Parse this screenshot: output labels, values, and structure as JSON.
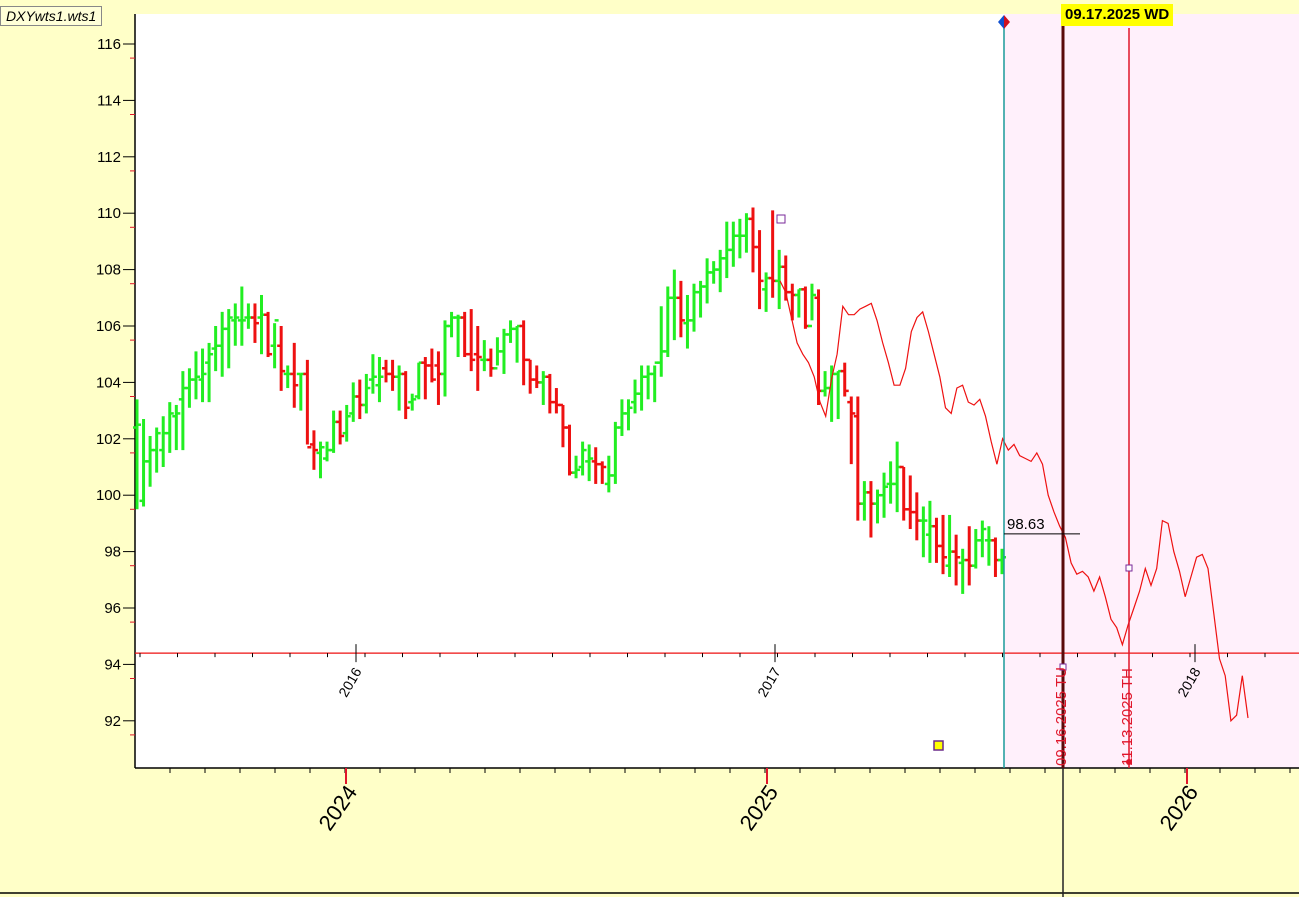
{
  "window": {
    "file_label": "DXYwts1.wts1",
    "selected_date_label": "09.17.2025 WD"
  },
  "chart_data": {
    "type": "bar",
    "y_ticks": [
      116,
      114,
      112,
      110,
      108,
      106,
      104,
      102,
      100,
      98,
      96,
      94,
      92
    ],
    "ylim": [
      90.3,
      117.2
    ],
    "grid": false,
    "price_label": "98.63",
    "outer_year_labels": [
      "2024",
      "2025",
      "2026"
    ],
    "inner_year_labels": [
      "2016",
      "2017",
      "2018"
    ],
    "vertical_labels": [
      "09.16.2025 TU",
      "11.13.2025 TH"
    ],
    "horizontal_line_value": 94.4,
    "colors": {
      "up": "#22ee22",
      "down": "#ee1111",
      "overlay_line": "#ee1111",
      "teal_marker": "#1a9a9a",
      "future_shade": "#fff0fb"
    },
    "price_bars": [
      [
        102.4,
        103.4,
        99.5,
        102.5
      ],
      [
        99.8,
        102.7,
        99.6,
        101.2
      ],
      [
        101.2,
        102.1,
        100.3,
        101.6
      ],
      [
        101.6,
        102.4,
        100.8,
        102.2
      ],
      [
        101.6,
        102.8,
        101.0,
        102.2
      ],
      [
        102.2,
        103.3,
        101.5,
        102.9
      ],
      [
        102.8,
        103.2,
        101.6,
        102.9
      ],
      [
        103.4,
        104.4,
        101.6,
        103.8
      ],
      [
        103.8,
        104.5,
        103.1,
        104.1
      ],
      [
        104.1,
        105.1,
        103.4,
        104.2
      ],
      [
        104.1,
        105.2,
        103.3,
        104.3
      ],
      [
        104.7,
        105.4,
        103.3,
        105.0
      ],
      [
        105.2,
        106.0,
        104.4,
        105.3
      ],
      [
        105.3,
        106.5,
        104.2,
        105.9
      ],
      [
        105.9,
        106.6,
        104.5,
        106.3
      ],
      [
        106.2,
        106.8,
        105.3,
        106.3
      ],
      [
        106.2,
        107.4,
        105.3,
        106.2
      ],
      [
        106.3,
        106.8,
        105.9,
        106.3
      ],
      [
        106.3,
        106.8,
        105.4,
        106.1
      ],
      [
        106.3,
        107.1,
        105.0,
        106.4
      ],
      [
        106.4,
        106.5,
        104.9,
        105.0
      ],
      [
        105.3,
        106.1,
        104.5,
        106.2
      ],
      [
        105.3,
        106.0,
        103.7,
        104.4
      ],
      [
        104.3,
        104.6,
        103.8,
        104.3
      ],
      [
        104.3,
        105.4,
        103.1,
        103.9
      ],
      [
        104.3,
        104.3,
        103.0,
        104.3
      ],
      [
        104.3,
        104.8,
        101.8,
        101.7
      ],
      [
        101.8,
        102.3,
        100.9,
        101.6
      ],
      [
        101.5,
        101.9,
        100.6,
        101.7
      ],
      [
        101.3,
        101.9,
        101.2,
        101.6
      ],
      [
        101.6,
        103.0,
        101.5,
        102.6
      ],
      [
        102.6,
        103.0,
        101.8,
        102.1
      ],
      [
        102.2,
        103.2,
        101.9,
        102.8
      ],
      [
        102.9,
        104.0,
        102.6,
        103.5
      ],
      [
        103.5,
        104.1,
        102.7,
        103.2
      ],
      [
        103.2,
        104.3,
        102.9,
        103.8
      ],
      [
        104.1,
        105.0,
        103.6,
        104.2
      ],
      [
        103.9,
        104.9,
        103.3,
        104.2
      ],
      [
        104.5,
        104.8,
        104.0,
        104.3
      ],
      [
        104.3,
        104.8,
        103.7,
        104.2
      ],
      [
        104.2,
        104.6,
        103.0,
        104.3
      ],
      [
        104.3,
        104.4,
        102.7,
        103.1
      ],
      [
        103.3,
        103.6,
        103.0,
        103.4
      ],
      [
        103.5,
        104.7,
        103.4,
        104.7
      ],
      [
        104.7,
        104.9,
        103.4,
        104.6
      ],
      [
        104.6,
        105.2,
        104.0,
        104.1
      ],
      [
        104.6,
        105.1,
        103.2,
        104.3
      ],
      [
        104.3,
        106.2,
        103.5,
        106.0
      ],
      [
        106.0,
        106.5,
        105.6,
        106.3
      ],
      [
        106.3,
        106.4,
        104.9,
        106.3
      ],
      [
        106.3,
        106.5,
        104.9,
        105.0
      ],
      [
        105.0,
        106.6,
        104.4,
        104.8
      ],
      [
        105.0,
        106.0,
        103.7,
        104.9
      ],
      [
        104.8,
        105.5,
        104.4,
        104.8
      ],
      [
        104.8,
        105.2,
        104.2,
        104.5
      ],
      [
        104.5,
        105.6,
        104.6,
        105.1
      ],
      [
        105.1,
        105.9,
        104.3,
        105.7
      ],
      [
        105.7,
        106.2,
        105.4,
        105.9
      ],
      [
        105.9,
        106.0,
        104.7,
        106.0
      ],
      [
        106.0,
        106.2,
        103.9,
        104.8
      ],
      [
        104.8,
        104.8,
        103.6,
        104.1
      ],
      [
        104.1,
        104.6,
        103.8,
        104.0
      ],
      [
        104.0,
        104.4,
        103.2,
        104.2
      ],
      [
        104.2,
        104.3,
        102.9,
        103.3
      ],
      [
        103.3,
        103.8,
        102.9,
        103.2
      ],
      [
        103.2,
        103.2,
        101.7,
        102.4
      ],
      [
        102.4,
        102.5,
        100.7,
        100.8
      ],
      [
        100.8,
        101.4,
        100.6,
        100.9
      ],
      [
        101.0,
        101.9,
        100.7,
        101.6
      ],
      [
        101.2,
        101.8,
        100.5,
        101.3
      ],
      [
        101.2,
        101.7,
        100.4,
        101.1
      ],
      [
        101.1,
        101.2,
        100.4,
        101.0
      ],
      [
        100.4,
        101.4,
        100.1,
        100.7
      ],
      [
        100.7,
        102.6,
        100.4,
        102.4
      ],
      [
        102.4,
        103.4,
        102.1,
        102.9
      ],
      [
        102.9,
        103.4,
        102.3,
        103.1
      ],
      [
        103.3,
        104.1,
        102.9,
        103.6
      ],
      [
        103.6,
        104.6,
        103.0,
        104.2
      ],
      [
        104.2,
        104.6,
        103.4,
        104.3
      ],
      [
        104.3,
        104.6,
        103.3,
        104.7
      ],
      [
        104.7,
        106.7,
        104.2,
        105.1
      ],
      [
        105.1,
        107.4,
        104.9,
        107.0
      ],
      [
        107.0,
        108.0,
        105.5,
        107.0
      ],
      [
        107.0,
        107.6,
        105.6,
        106.2
      ],
      [
        106.1,
        107.1,
        105.2,
        106.2
      ],
      [
        106.2,
        107.5,
        105.8,
        107.2
      ],
      [
        107.2,
        107.6,
        106.3,
        107.4
      ],
      [
        107.4,
        108.4,
        106.8,
        107.9
      ],
      [
        107.9,
        108.3,
        107.5,
        108.0
      ],
      [
        108.0,
        108.7,
        107.2,
        108.4
      ],
      [
        108.4,
        109.7,
        107.7,
        108.7
      ],
      [
        108.7,
        109.7,
        108.1,
        109.2
      ],
      [
        109.2,
        109.8,
        108.4,
        109.2
      ],
      [
        109.2,
        110.0,
        108.6,
        109.8
      ],
      [
        109.8,
        110.2,
        107.9,
        108.8
      ],
      [
        108.8,
        109.4,
        106.6,
        107.6
      ],
      [
        107.3,
        107.9,
        106.5,
        107.7
      ],
      [
        107.7,
        110.1,
        107.0,
        107.6
      ],
      [
        107.6,
        108.7,
        106.6,
        108.1
      ],
      [
        108.1,
        108.5,
        106.9,
        107.2
      ],
      [
        107.2,
        107.5,
        106.2,
        107.1
      ],
      [
        107.1,
        107.3,
        106.3,
        107.3
      ],
      [
        107.3,
        107.4,
        105.9,
        106.0
      ],
      [
        106.0,
        107.5,
        106.2,
        107.1
      ],
      [
        107.0,
        107.3,
        103.2,
        103.7
      ],
      [
        103.7,
        104.4,
        103.5,
        103.8
      ],
      [
        103.8,
        104.6,
        102.6,
        104.3
      ],
      [
        104.3,
        104.4,
        102.7,
        104.4
      ],
      [
        104.4,
        104.7,
        103.5,
        103.7
      ],
      [
        103.3,
        103.5,
        101.1,
        102.9
      ],
      [
        102.8,
        103.5,
        99.1,
        99.7
      ],
      [
        99.7,
        100.5,
        99.1,
        100.1
      ],
      [
        100.1,
        100.5,
        98.5,
        99.7
      ],
      [
        99.7,
        100.2,
        99.0,
        100.0
      ],
      [
        100.0,
        100.8,
        99.2,
        100.3
      ],
      [
        100.4,
        101.2,
        99.7,
        100.4
      ],
      [
        100.4,
        101.9,
        99.4,
        101.0
      ],
      [
        101.0,
        101.0,
        99.1,
        99.5
      ],
      [
        99.5,
        100.7,
        98.8,
        99.4
      ],
      [
        99.4,
        100.1,
        98.4,
        99.1
      ],
      [
        99.1,
        99.6,
        97.8,
        99.1
      ],
      [
        98.6,
        99.8,
        97.6,
        98.9
      ],
      [
        98.9,
        99.2,
        97.6,
        98.2
      ],
      [
        98.2,
        99.3,
        97.2,
        97.8
      ],
      [
        97.5,
        99.3,
        97.1,
        98.0
      ],
      [
        98.0,
        98.6,
        96.8,
        97.8
      ],
      [
        97.6,
        98.1,
        96.5,
        97.7
      ],
      [
        97.7,
        98.9,
        96.8,
        97.5
      ],
      [
        97.5,
        98.8,
        97.4,
        98.4
      ],
      [
        98.4,
        99.1,
        97.8,
        98.8
      ],
      [
        98.4,
        98.9,
        97.5,
        98.4
      ],
      [
        98.4,
        98.5,
        97.1,
        97.7
      ],
      [
        97.7,
        98.1,
        97.2,
        97.8
      ]
    ],
    "forecast_line": [
      [
        0,
        107.6
      ],
      [
        1,
        107.2
      ],
      [
        2,
        106.3
      ],
      [
        3,
        105.4
      ],
      [
        4,
        105.0
      ],
      [
        5,
        104.7
      ],
      [
        6,
        104.2
      ],
      [
        7,
        103.3
      ],
      [
        8,
        102.8
      ],
      [
        9,
        104.1
      ],
      [
        10,
        105.0
      ],
      [
        11,
        106.7
      ],
      [
        12,
        106.4
      ],
      [
        13,
        106.4
      ],
      [
        14,
        106.6
      ],
      [
        15,
        106.7
      ],
      [
        16,
        106.8
      ],
      [
        17,
        106.2
      ],
      [
        18,
        105.4
      ],
      [
        19,
        104.7
      ],
      [
        20,
        103.9
      ],
      [
        21,
        103.9
      ],
      [
        22,
        104.5
      ],
      [
        23,
        105.8
      ],
      [
        24,
        106.3
      ],
      [
        25,
        106.5
      ],
      [
        26,
        105.8
      ],
      [
        27,
        105.0
      ],
      [
        28,
        104.2
      ],
      [
        29,
        103.1
      ],
      [
        30,
        102.9
      ],
      [
        31,
        103.8
      ],
      [
        32,
        103.9
      ],
      [
        33,
        103.3
      ],
      [
        34,
        103.2
      ],
      [
        35,
        103.4
      ],
      [
        36,
        102.8
      ],
      [
        37,
        101.9
      ],
      [
        38,
        101.1
      ],
      [
        39,
        102.0
      ],
      [
        40,
        101.6
      ],
      [
        41,
        101.8
      ],
      [
        42,
        101.4
      ],
      [
        43,
        101.3
      ],
      [
        44,
        101.2
      ],
      [
        45,
        101.5
      ],
      [
        46,
        101.1
      ],
      [
        47,
        100.0
      ],
      [
        48,
        99.4
      ],
      [
        49,
        98.9
      ],
      [
        50,
        98.5
      ],
      [
        51,
        97.6
      ],
      [
        52,
        97.2
      ],
      [
        53,
        97.3
      ],
      [
        54,
        97.1
      ],
      [
        55,
        96.6
      ],
      [
        56,
        97.1
      ],
      [
        57,
        96.4
      ],
      [
        58,
        95.6
      ],
      [
        59,
        95.3
      ],
      [
        60,
        94.7
      ],
      [
        61,
        95.4
      ],
      [
        62,
        96.0
      ],
      [
        63,
        96.6
      ],
      [
        64,
        97.4
      ],
      [
        65,
        96.8
      ],
      [
        66,
        97.4
      ],
      [
        67,
        99.1
      ],
      [
        68,
        99.0
      ],
      [
        69,
        98.0
      ],
      [
        70,
        97.3
      ],
      [
        71,
        96.4
      ],
      [
        72,
        97.1
      ],
      [
        73,
        97.8
      ],
      [
        74,
        97.9
      ],
      [
        75,
        97.4
      ],
      [
        76,
        95.8
      ],
      [
        77,
        94.2
      ],
      [
        78,
        93.6
      ],
      [
        79,
        92.0
      ],
      [
        80,
        92.2
      ],
      [
        81,
        93.6
      ],
      [
        82,
        92.1
      ]
    ]
  }
}
